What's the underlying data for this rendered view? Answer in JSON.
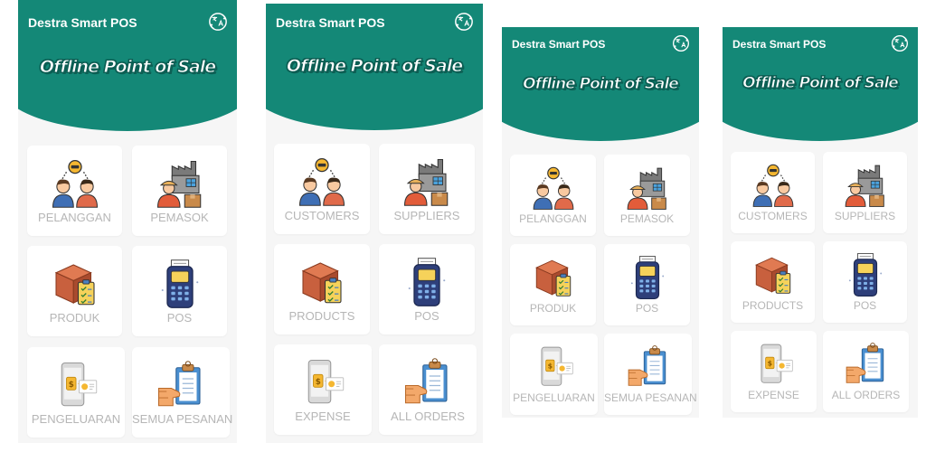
{
  "app": {
    "title": "Destra Smart POS",
    "banner": "Offline Point of Sale"
  },
  "colors": {
    "header": "#148877",
    "background": "#f6f6f6",
    "card": "#ffffff",
    "label": "#b6b6b6"
  },
  "screens": [
    {
      "language": "Indonesian",
      "menu": [
        {
          "label": "PELANGGAN",
          "icon": "customers-icon"
        },
        {
          "label": "PEMASOK",
          "icon": "suppliers-icon"
        },
        {
          "label": "PRODUK",
          "icon": "products-icon"
        },
        {
          "label": "POS",
          "icon": "pos-terminal-icon"
        },
        {
          "label": "PENGELUARAN",
          "icon": "expense-icon"
        },
        {
          "label": "SEMUA PESANAN",
          "icon": "all-orders-icon"
        }
      ]
    },
    {
      "language": "English",
      "menu": [
        {
          "label": "CUSTOMERS",
          "icon": "customers-icon"
        },
        {
          "label": "SUPPLIERS",
          "icon": "suppliers-icon"
        },
        {
          "label": "PRODUCTS",
          "icon": "products-icon"
        },
        {
          "label": "POS",
          "icon": "pos-terminal-icon"
        },
        {
          "label": "EXPENSE",
          "icon": "expense-icon"
        },
        {
          "label": "ALL ORDERS",
          "icon": "all-orders-icon"
        }
      ]
    },
    {
      "language": "Indonesian",
      "menu": [
        {
          "label": "PELANGGAN",
          "icon": "customers-icon"
        },
        {
          "label": "PEMASOK",
          "icon": "suppliers-icon"
        },
        {
          "label": "PRODUK",
          "icon": "products-icon"
        },
        {
          "label": "POS",
          "icon": "pos-terminal-icon"
        },
        {
          "label": "PENGELUARAN",
          "icon": "expense-icon"
        },
        {
          "label": "SEMUA PESANAN",
          "icon": "all-orders-icon"
        }
      ]
    },
    {
      "language": "English",
      "menu": [
        {
          "label": "CUSTOMERS",
          "icon": "customers-icon"
        },
        {
          "label": "SUPPLIERS",
          "icon": "suppliers-icon"
        },
        {
          "label": "PRODUCTS",
          "icon": "products-icon"
        },
        {
          "label": "POS",
          "icon": "pos-terminal-icon"
        },
        {
          "label": "EXPENSE",
          "icon": "expense-icon"
        },
        {
          "label": "ALL ORDERS",
          "icon": "all-orders-icon"
        }
      ]
    }
  ]
}
